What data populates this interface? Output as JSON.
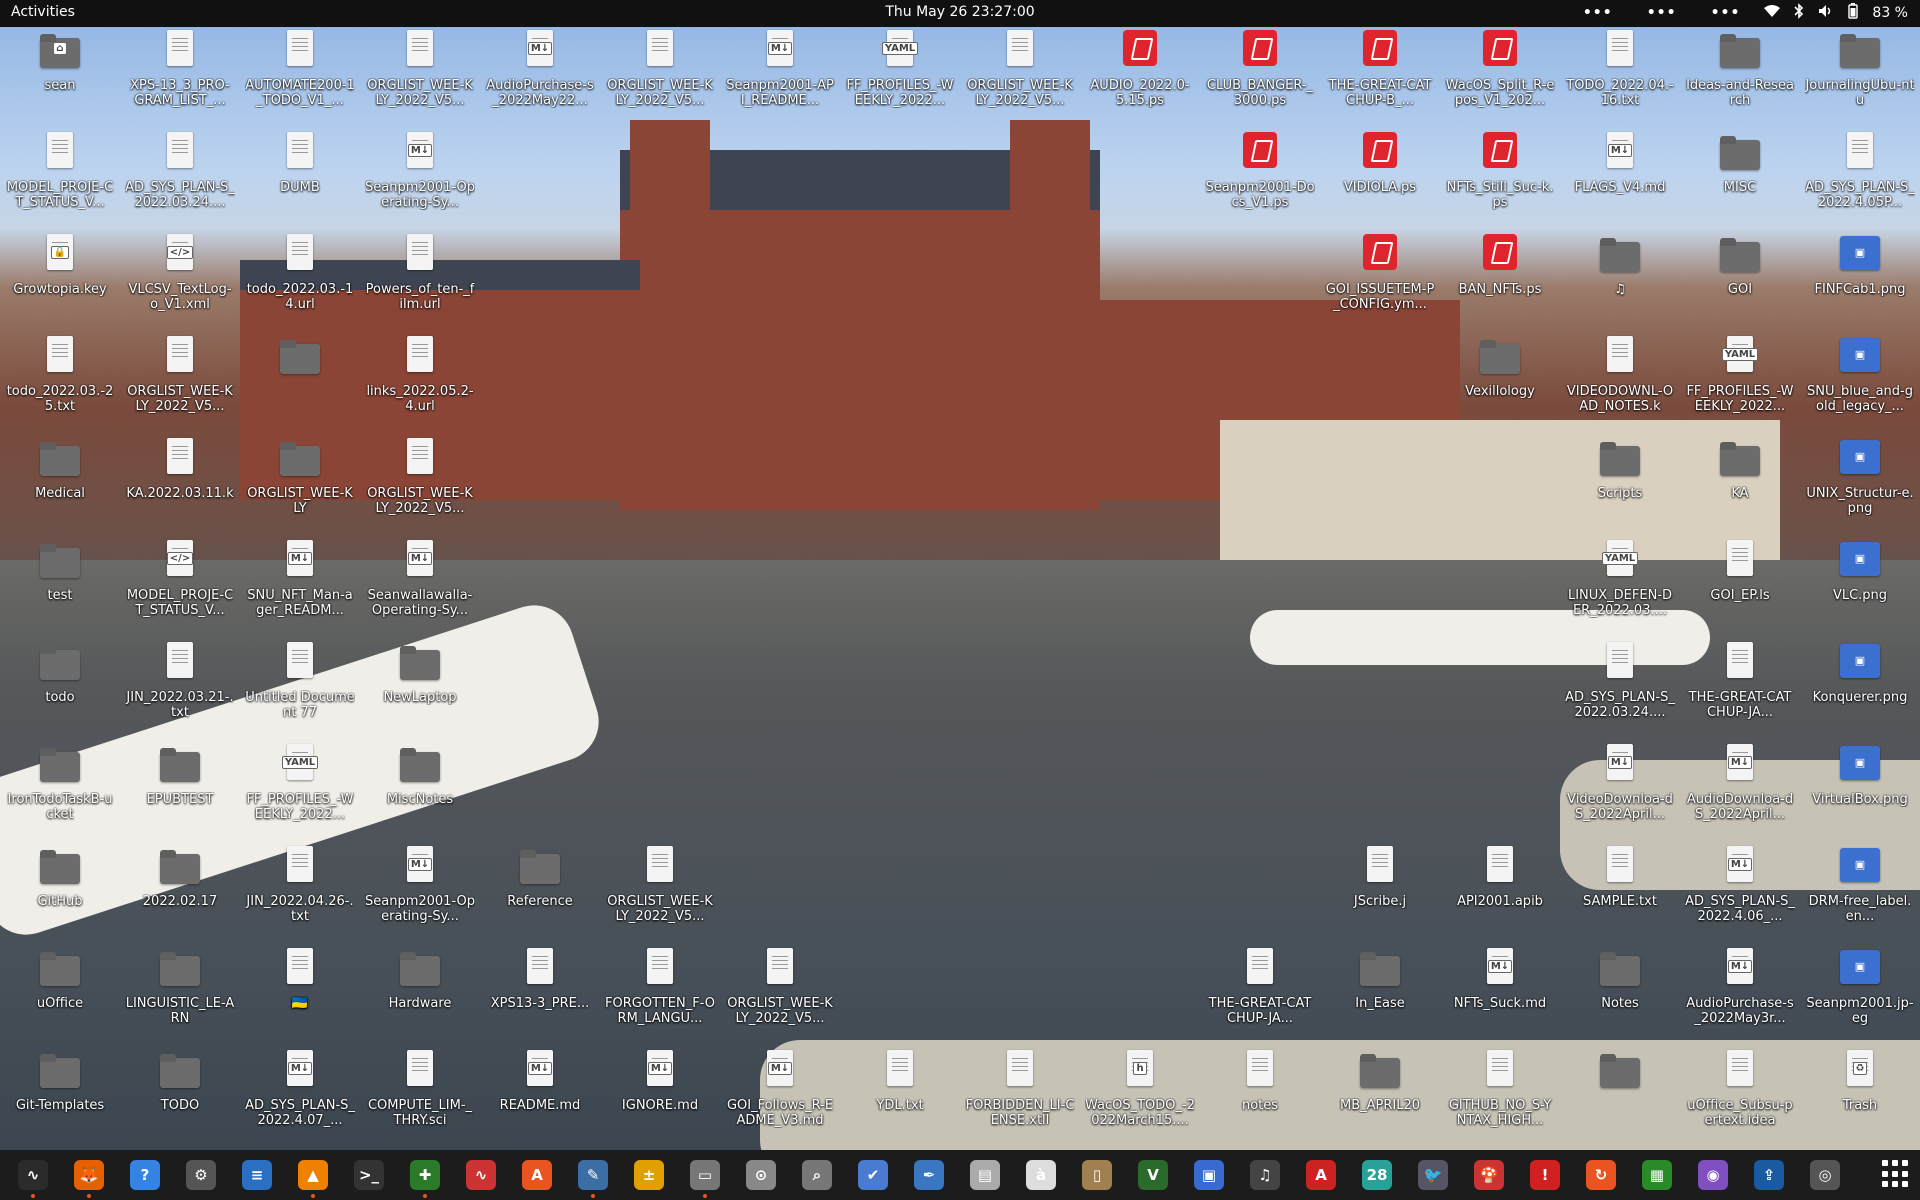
{
  "topbar": {
    "activities": "Activities",
    "clock": "Thu May 26  23:27:00",
    "menu_dots": [
      "•••",
      "•••",
      "•••"
    ],
    "battery": "83 %",
    "tray_icons": [
      "wifi-icon",
      "bluetooth-icon",
      "volume-icon",
      "battery-icon"
    ]
  },
  "desktop": {
    "icons": [
      {
        "label": "sean",
        "type": "folder-home"
      },
      {
        "label": "XPS-13_3_PRO-GRAM_LIST_...",
        "type": "file"
      },
      {
        "label": "AUTOMATE200-1_TODO_V1_...",
        "type": "file"
      },
      {
        "label": "ORGLIST_WEE-KLY_2022_V5...",
        "type": "file"
      },
      {
        "label": "AudioPurchase-s_2022May22...",
        "type": "md"
      },
      {
        "label": "ORGLIST_WEE-KLY_2022_V5...",
        "type": "file"
      },
      {
        "label": "Seanpm2001-API_README...",
        "type": "md"
      },
      {
        "label": "FF_PROFILES_-WEEKLY_2022...",
        "type": "yaml"
      },
      {
        "label": "ORGLIST_WEE-KLY_2022_V5...",
        "type": "file"
      },
      {
        "label": "AUDIO_2022.0-5.15.ps",
        "type": "ps"
      },
      {
        "label": "CLUB_BANGER-_3000.ps",
        "type": "ps"
      },
      {
        "label": "THE-GREAT-CATCHUP-B_...",
        "type": "ps"
      },
      {
        "label": "WacOS_Split_R-epos_V1_202...",
        "type": "ps"
      },
      {
        "label": "TODO_2022.04.-16.txt",
        "type": "file"
      },
      {
        "label": "Ideas-and-Research",
        "type": "folder"
      },
      {
        "label": "JournalingUbu-ntu",
        "type": "folder"
      },
      {
        "label": "MODEL_PROJE-CT_STATUS_V...",
        "type": "file"
      },
      {
        "label": "AD_SYS_PLAN-S_2022.03.24....",
        "type": "file"
      },
      {
        "label": "DUMB",
        "type": "file"
      },
      {
        "label": "Seanpm2001-Operating-Sy...",
        "type": "md"
      },
      {
        "label": "Seanpm2001-Docs_V1.ps",
        "type": "ps"
      },
      {
        "label": "VIDIOLA.ps",
        "type": "ps"
      },
      {
        "label": "NFTs_Still_Suc-k.ps",
        "type": "ps"
      },
      {
        "label": "FLAGS_V4.md",
        "type": "md"
      },
      {
        "label": "MISC",
        "type": "folder"
      },
      {
        "label": "AD_SYS_PLAN-S_2022.4.05P...",
        "type": "file"
      },
      {
        "label": "Growtopia.key",
        "type": "key"
      },
      {
        "label": "VLCSV_TextLog-o_V1.xml",
        "type": "xml"
      },
      {
        "label": "todo_2022.03.-14.url",
        "type": "file"
      },
      {
        "label": "Powers_of_ten-_film.url",
        "type": "file"
      },
      {
        "label": "GOI_ISSUETEM-P_CONFIG.ym...",
        "type": "ps"
      },
      {
        "label": "BAN_NFTs.ps",
        "type": "ps"
      },
      {
        "label": "♫",
        "type": "folder"
      },
      {
        "label": "GOI",
        "type": "folder"
      },
      {
        "label": "FINFCab1.png",
        "type": "image"
      },
      {
        "label": "todo_2022.03.-25.txt",
        "type": "file"
      },
      {
        "label": "ORGLIST_WEE-KLY_2022_V5...",
        "type": "file"
      },
      {
        "label": "",
        "type": "folder"
      },
      {
        "label": "links_2022.05.2-4.url",
        "type": "file"
      },
      {
        "label": "Vexillology",
        "type": "folder"
      },
      {
        "label": "VIDEODOWNL-OAD_NOTES.k",
        "type": "file"
      },
      {
        "label": "FF_PROFILES_-WEEKLY_2022...",
        "type": "yaml"
      },
      {
        "label": "SNU_blue_and-gold_legacy_...",
        "type": "image"
      },
      {
        "label": "Medical",
        "type": "folder"
      },
      {
        "label": "KA.2022.03.11.k",
        "type": "file"
      },
      {
        "label": "ORGLIST_WEE-KLY",
        "type": "folder"
      },
      {
        "label": "ORGLIST_WEE-KLY_2022_V5...",
        "type": "file"
      },
      {
        "label": "Scripts",
        "type": "folder"
      },
      {
        "label": "KA",
        "type": "folder"
      },
      {
        "label": "UNIX_Structur-e.png",
        "type": "image"
      },
      {
        "label": "test",
        "type": "folder"
      },
      {
        "label": "MODEL_PROJE-CT_STATUS_V...",
        "type": "xml"
      },
      {
        "label": "SNU_NFT_Man-ager_READM...",
        "type": "md"
      },
      {
        "label": "Seanwallawalla-Operating-Sy...",
        "type": "md"
      },
      {
        "label": "LINUX_DEFEN-DER_2022.03....",
        "type": "yaml"
      },
      {
        "label": "GOI_EP.ls",
        "type": "file"
      },
      {
        "label": "VLC.png",
        "type": "image"
      },
      {
        "label": "todo",
        "type": "folder"
      },
      {
        "label": "JIN_2022.03.21-.txt",
        "type": "file"
      },
      {
        "label": "Untitled Document 77",
        "type": "file"
      },
      {
        "label": "NewLaptop",
        "type": "folder"
      },
      {
        "label": "AD_SYS_PLAN-S_2022.03.24....",
        "type": "file"
      },
      {
        "label": "THE-GREAT-CATCHUP-JA...",
        "type": "file"
      },
      {
        "label": "Konquerer.png",
        "type": "image"
      },
      {
        "label": "IronTodoTaskB-ucket",
        "type": "folder"
      },
      {
        "label": "EPUBTEST",
        "type": "folder"
      },
      {
        "label": "FF_PROFILES_-WEEKLY_2022...",
        "type": "yaml"
      },
      {
        "label": "MiscNotes",
        "type": "folder"
      },
      {
        "label": "VideoDownloa-dS_2022April...",
        "type": "md"
      },
      {
        "label": "AudioDownloa-dS_2022April...",
        "type": "md"
      },
      {
        "label": "VirtualBox.png",
        "type": "image"
      },
      {
        "label": "GitHub",
        "type": "folder"
      },
      {
        "label": "2022.02.17",
        "type": "folder"
      },
      {
        "label": "JIN_2022.04.26-.txt",
        "type": "file"
      },
      {
        "label": "Seanpm2001-Operating-Sy...",
        "type": "md"
      },
      {
        "label": "Reference",
        "type": "folder"
      },
      {
        "label": "ORGLIST_WEE-KLY_2022_V5...",
        "type": "file"
      },
      {
        "label": "JScribe.j",
        "type": "file"
      },
      {
        "label": "API2001.apib",
        "type": "file"
      },
      {
        "label": "SAMPLE.txt",
        "type": "file"
      },
      {
        "label": "AD_SYS_PLAN-S_2022.4.06_...",
        "type": "md"
      },
      {
        "label": "DRM-free_label.en...",
        "type": "image"
      },
      {
        "label": "uOffice",
        "type": "folder"
      },
      {
        "label": "LINGUISTIC_LE-ARN",
        "type": "folder"
      },
      {
        "label": "🇺🇦",
        "type": "file"
      },
      {
        "label": "Hardware",
        "type": "folder"
      },
      {
        "label": "XPS13-3_PRE...",
        "type": "file"
      },
      {
        "label": "FORGOTTEN_F-ORM_LANGU...",
        "type": "file"
      },
      {
        "label": "ORGLIST_WEE-KLY_2022_V5...",
        "type": "file"
      },
      {
        "label": "THE-GREAT-CATCHUP-JA...",
        "type": "file"
      },
      {
        "label": "In_Ease",
        "type": "folder"
      },
      {
        "label": "NFTs_Suck.md",
        "type": "md"
      },
      {
        "label": "Notes",
        "type": "folder"
      },
      {
        "label": "AudioPurchase-s_2022May3r...",
        "type": "md"
      },
      {
        "label": "Seanpm2001.jp-eg",
        "type": "image"
      },
      {
        "label": "Git-Templates",
        "type": "folder"
      },
      {
        "label": "TODO",
        "type": "folder"
      },
      {
        "label": "AD_SYS_PLAN-S_2022.4.07_...",
        "type": "md"
      },
      {
        "label": "COMPUTE_LIM-_THRY.sci",
        "type": "file"
      },
      {
        "label": "README.md",
        "type": "md"
      },
      {
        "label": "IGNORE.md",
        "type": "md"
      },
      {
        "label": "GOI_Follows_R-EADME_V3.md",
        "type": "md"
      },
      {
        "label": "YDL.txt",
        "type": "file"
      },
      {
        "label": "FORBIDDEN_LI-CENSE.xtll",
        "type": "file"
      },
      {
        "label": "WacOS_TODO_-2022March15....",
        "type": "h"
      },
      {
        "label": "notes",
        "type": "file"
      },
      {
        "label": "MB_APRIL20",
        "type": "folder"
      },
      {
        "label": "GITHUB_NO_S-YNTAX_HIGH...",
        "type": "file"
      },
      {
        "label": "",
        "type": "folder"
      },
      {
        "label": "uOffice_Subsu-pertext.idea",
        "type": "file"
      },
      {
        "label": "Trash",
        "type": "trash"
      }
    ]
  },
  "dock": {
    "items": [
      {
        "name": "system-monitor-icon",
        "glyph": "∿",
        "color": "#2b2b2b",
        "running": true
      },
      {
        "name": "firefox-icon",
        "glyph": "🦊",
        "color": "#e66000",
        "running": true
      },
      {
        "name": "help-icon",
        "glyph": "?",
        "color": "#3584e4",
        "running": false
      },
      {
        "name": "settings-icon",
        "glyph": "⚙",
        "color": "#555",
        "running": false
      },
      {
        "name": "text-document-icon",
        "glyph": "≡",
        "color": "#2a6fc2",
        "running": false
      },
      {
        "name": "vlc-icon",
        "glyph": "▲",
        "color": "#f08000",
        "running": true
      },
      {
        "name": "terminal-icon",
        "glyph": ">_",
        "color": "#333",
        "running": false
      },
      {
        "name": "gimp-like-icon",
        "glyph": "✚",
        "color": "#2a7a2a",
        "running": true
      },
      {
        "name": "graph-icon",
        "glyph": "∿",
        "color": "#c33",
        "running": false
      },
      {
        "name": "software-center-icon",
        "glyph": "A",
        "color": "#e95420",
        "running": false
      },
      {
        "name": "text-editor-icon",
        "glyph": "✎",
        "color": "#3a6ea5",
        "running": true
      },
      {
        "name": "calculator-icon",
        "glyph": "±",
        "color": "#e0a000",
        "running": false
      },
      {
        "name": "files-icon",
        "glyph": "▭",
        "color": "#777",
        "running": true
      },
      {
        "name": "maps-icon",
        "glyph": "⊙",
        "color": "#888",
        "running": false
      },
      {
        "name": "search-icon",
        "glyph": "⌕",
        "color": "#777",
        "running": false
      },
      {
        "name": "tasks-icon",
        "glyph": "✔",
        "color": "#4a7bd0",
        "running": false
      },
      {
        "name": "pen-icon",
        "glyph": "✒",
        "color": "#3a77c0",
        "running": false
      },
      {
        "name": "scanner-icon",
        "glyph": "▤",
        "color": "#aaa",
        "running": false
      },
      {
        "name": "character-map-icon",
        "glyph": "à",
        "color": "#ddd",
        "running": false
      },
      {
        "name": "archive-icon",
        "glyph": "▯",
        "color": "#a08050",
        "running": false
      },
      {
        "name": "vim-icon",
        "glyph": "V",
        "color": "#2a6a2a",
        "running": false
      },
      {
        "name": "screen-icon",
        "glyph": "▣",
        "color": "#3a6ad0",
        "running": false
      },
      {
        "name": "music-icon",
        "glyph": "♫",
        "color": "#444",
        "running": false
      },
      {
        "name": "pdf-viewer-icon",
        "glyph": "A",
        "color": "#cc2222",
        "running": false
      },
      {
        "name": "calendar-icon",
        "glyph": "28",
        "color": "#2aa198",
        "running": false
      },
      {
        "name": "bird-icon",
        "glyph": "🐦",
        "color": "#556",
        "running": false
      },
      {
        "name": "mario-icon",
        "glyph": "🍄",
        "color": "#c33",
        "running": false
      },
      {
        "name": "alert-icon",
        "glyph": "!",
        "color": "#d02020",
        "running": false
      },
      {
        "name": "updater-icon",
        "glyph": "↻",
        "color": "#e95420",
        "running": false
      },
      {
        "name": "spreadsheet-icon",
        "glyph": "▦",
        "color": "#2a8a2a",
        "running": false
      },
      {
        "name": "screenshot-icon",
        "glyph": "◉",
        "color": "#8050c0",
        "running": false
      },
      {
        "name": "upload-icon",
        "glyph": "⇪",
        "color": "#1a5aa0",
        "running": false
      },
      {
        "name": "ubuntu-icon",
        "glyph": "◎",
        "color": "#555",
        "running": false
      }
    ]
  },
  "colors": {
    "topbar": "#111111",
    "dock": "#1c1c1c",
    "accent": "#e95420"
  }
}
